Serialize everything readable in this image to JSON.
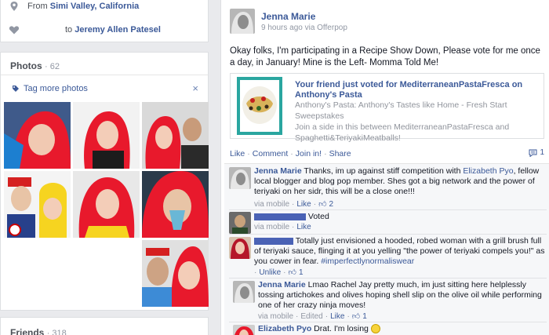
{
  "intro": {
    "from_prefix": "From",
    "from_place": "Simi Valley, California",
    "to_prefix": "to",
    "to_name": "Jeremy Allen Patesel"
  },
  "photos": {
    "title": "Photos",
    "count": "· 62",
    "tag_more": "Tag more photos",
    "close": "×"
  },
  "friends": {
    "title": "Friends",
    "count": "· 318"
  },
  "post": {
    "author": "Jenna Marie",
    "meta": "9 hours ago via Offerpop",
    "text": "Okay folks, I'm participating in a Recipe Show Down, Please vote for me once a day, in January! Mine is the Left- Momma Told Me!",
    "card": {
      "title": "Your friend just voted for MediterraneanPastaFresca on Anthony's Pasta",
      "line1": "Anthony's Pasta: Anthony's Tastes like Home - Fresh Start Sweepstakes",
      "line2": "Join a side in this between MediterraneanPastaFresca and Spaghetti&TeriyakiMeatballs!"
    },
    "actions": {
      "like": "Like",
      "comment": "Comment",
      "join": "Join in!",
      "share": "Share",
      "sep": "·",
      "comment_count": "1"
    }
  },
  "comments": [
    {
      "author": "Jenna Marie",
      "text_before": " Thanks, im up against stiff competition with ",
      "mention": "Elizabeth Pyo",
      "text_after": ", fellow local blogger and blog pop member. Shes got a big network and the power of teriyaki on her sidr, this will be a close one!!!",
      "meta_via": "via mobile",
      "meta_like": "Like",
      "meta_likes": "2",
      "sep": "·"
    },
    {
      "text": " Voted",
      "meta_via": "via mobile",
      "meta_like": "Like",
      "sep": "·"
    },
    {
      "text": " Totally just envisioned a hooded, robed woman with a grill brush full of teriyaki sauce, flinging it at you yelling \"the power of teriyaki compels you!\" as you cower in fear. ",
      "hashtag": "#imperfectlynormaliswear",
      "meta_unlike": "Unlike",
      "meta_likes": "1",
      "sep": "·"
    },
    {
      "author": "Jenna Marie",
      "text": " Lmao Rachel Jay pretty much, im just sitting here helplessly tossing artichokes and olives hoping shell slip on the olive oil while performing one of her crazy ninja moves!",
      "meta_via": "via mobile",
      "meta_edited": "Edited",
      "meta_like": "Like",
      "meta_likes": "1",
      "sep": "·"
    },
    {
      "author": "Elizabeth Pyo",
      "text": " Drat. I'm losing"
    }
  ],
  "colors": {
    "link": "#3b5998",
    "hair_red": "#e8192c",
    "page_bg": "#e9eaed"
  }
}
